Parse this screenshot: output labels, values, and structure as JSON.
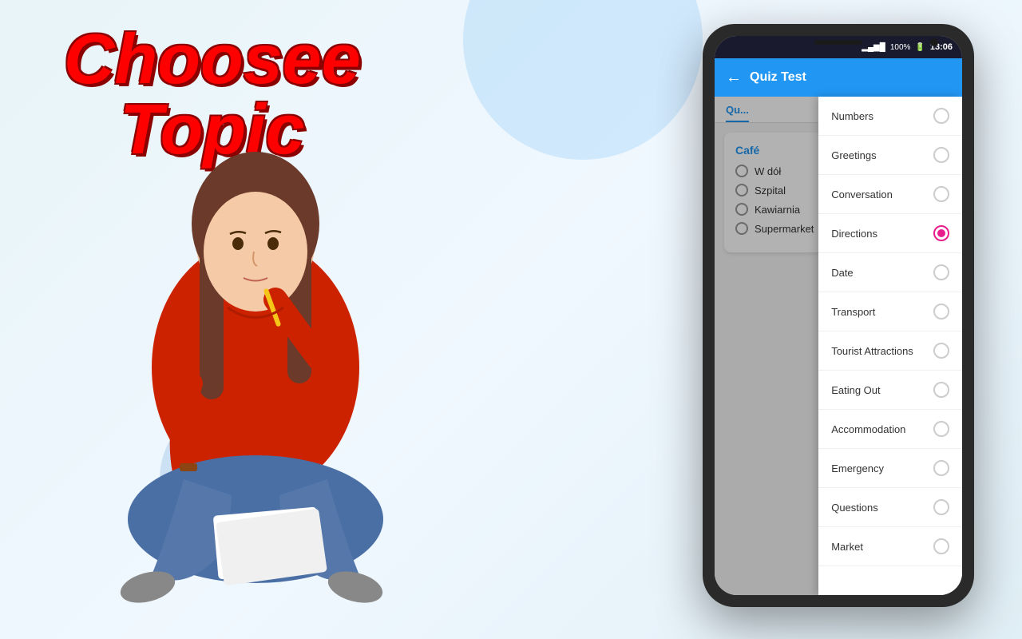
{
  "background": {
    "color": "#e8f4f8"
  },
  "title": {
    "line1": "Choosee",
    "line2": "Topic"
  },
  "phone": {
    "status": {
      "signal": "▂▄▆█",
      "battery": "100%",
      "time": "13:06"
    },
    "header": {
      "back_icon": "←",
      "title": "Quiz Test"
    },
    "quiz_tab": "Qu...",
    "card": {
      "title": "Café",
      "options": [
        "W dół",
        "Szpital",
        "Kawiarnia",
        "Supermarket"
      ]
    },
    "dropdown": {
      "items": [
        {
          "label": "Numbers",
          "selected": false
        },
        {
          "label": "Greetings",
          "selected": false
        },
        {
          "label": "Conversation",
          "selected": false
        },
        {
          "label": "Directions",
          "selected": true
        },
        {
          "label": "Date",
          "selected": false
        },
        {
          "label": "Transport",
          "selected": false
        },
        {
          "label": "Tourist Attractions",
          "selected": false
        },
        {
          "label": "Eating Out",
          "selected": false
        },
        {
          "label": "Accommodation",
          "selected": false
        },
        {
          "label": "Emergency",
          "selected": false
        },
        {
          "label": "Questions",
          "selected": false
        },
        {
          "label": "Market",
          "selected": false
        }
      ]
    }
  }
}
